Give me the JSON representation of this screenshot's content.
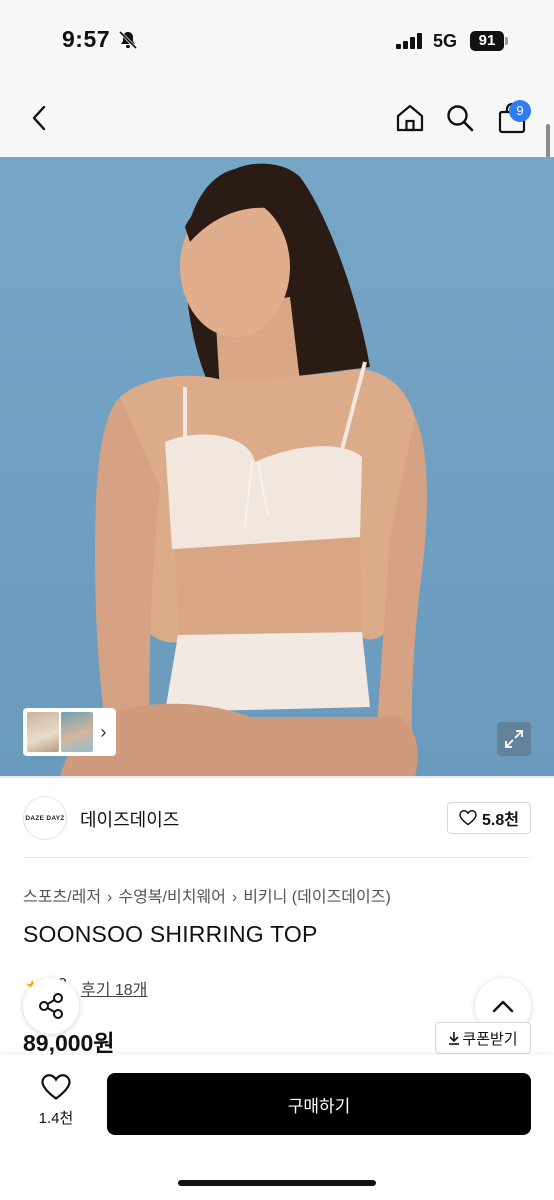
{
  "status_bar": {
    "time": "9:57",
    "network": "5G",
    "battery": "91",
    "icons": [
      "bell-off-icon",
      "signal-icon"
    ]
  },
  "header": {
    "icons": [
      "back-icon",
      "home-icon",
      "search-icon",
      "cart-icon"
    ],
    "cart_badge": "9"
  },
  "gallery": {
    "icons": [
      "chevron-right-icon",
      "expand-icon"
    ]
  },
  "brand": {
    "logo_text": "DAZE DAYZ",
    "name": "데이즈데이즈",
    "like_count": "5.8천"
  },
  "breadcrumb": [
    "스포츠/레저",
    "수영복/비치웨어",
    "비키니 (데이즈데이즈)"
  ],
  "product": {
    "title": "SOONSOO SHIRRING TOP",
    "rating": "3",
    "review_link": "후기 18개",
    "price": "89,000원",
    "coupon_label": "쿠폰받기"
  },
  "bottom_bar": {
    "wish_count": "1.4천",
    "buy_label": "구매하기"
  },
  "colors": {
    "accent_badge": "#2f7cf6",
    "buy_button": "#000000",
    "sky": "#78a6c6",
    "star": "#f5b400"
  }
}
